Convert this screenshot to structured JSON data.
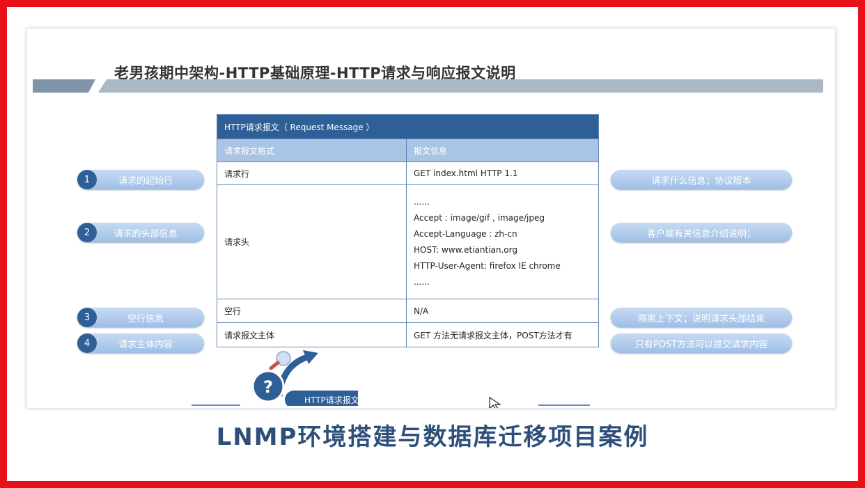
{
  "slide": {
    "title": "老男孩期中架构-HTTP基础原理-HTTP请求与响应报文说明"
  },
  "table": {
    "header": "HTTP请求报文（ Request Message ）",
    "col_left": "请求报文格式",
    "col_right": "报文信息",
    "rows": [
      {
        "name": "请求行",
        "info": "GET index.html HTTP 1.1"
      },
      {
        "name": "请求头",
        "info_lines": [
          "......",
          "Accept : image/gif , image/jpeg",
          "Accept-Language : zh-cn",
          "HOST: www.etiantian.org",
          "HTTP-User-Agent: firefox IE chrome",
          "......"
        ]
      },
      {
        "name": "空行",
        "info": "N/A"
      },
      {
        "name": "请求报文主体",
        "info": "GET 方法无请求报文主体，POST方法才有"
      }
    ]
  },
  "left_pills": [
    {
      "num": "1",
      "label": "请求的起始行"
    },
    {
      "num": "2",
      "label": "请求的头部信息"
    },
    {
      "num": "3",
      "label": "空行信息"
    },
    {
      "num": "4",
      "label": "请求主体内容"
    }
  ],
  "right_pills": [
    {
      "label": "请求什么信息；协议版本"
    },
    {
      "label": "客户端有关信息介绍说明；"
    },
    {
      "label": "隔离上下文；说明请求头部结束"
    },
    {
      "label": "只有POST方法可以提交请求内容"
    }
  ],
  "graphic": {
    "symbol": "?",
    "label": "HTTP请求报文"
  },
  "footer": {
    "title": "LNMP环境搭建与数据库迁移项目案例"
  },
  "colors": {
    "frame": "#e8111a",
    "table_header": "#2f5f97",
    "table_col_header": "#a9c4e4",
    "pill": "#b3cdee",
    "footer_text": "#2e4f7a"
  }
}
